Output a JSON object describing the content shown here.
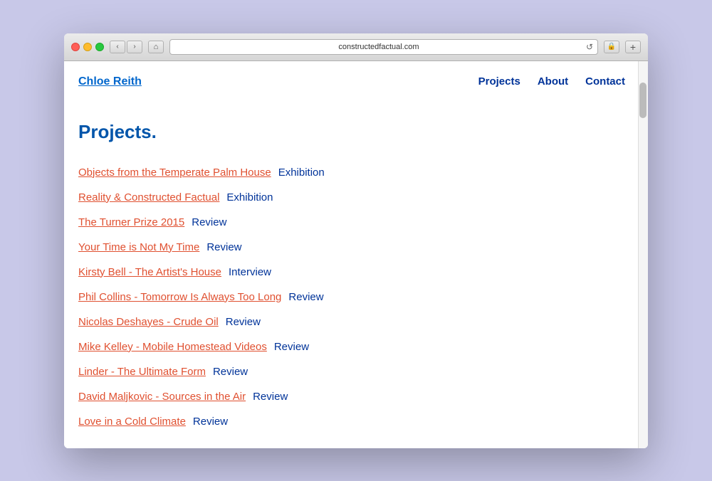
{
  "browser": {
    "url": "constructedfactual.com",
    "back_btn": "‹",
    "forward_btn": "›",
    "home_icon": "⌂",
    "refresh_icon": "↺",
    "security_icon": "⬛",
    "new_tab_icon": "+"
  },
  "site": {
    "logo": "Chloe Reith",
    "nav_links": [
      {
        "label": "Projects",
        "href": "#"
      },
      {
        "label": "About",
        "href": "#"
      },
      {
        "label": "Contact",
        "href": "#"
      }
    ]
  },
  "main": {
    "title": "Projects.",
    "projects": [
      {
        "title": "Objects from the Temperate Palm House",
        "type": "Exhibition"
      },
      {
        "title": "Reality & Constructed Factual",
        "type": "Exhibition"
      },
      {
        "title": "The Turner Prize 2015",
        "type": "Review"
      },
      {
        "title": "Your Time is Not My Time",
        "type": "Review"
      },
      {
        "title": "Kirsty Bell - The Artist's House",
        "type": "Interview"
      },
      {
        "title": "Phil Collins - Tomorrow Is Always Too Long",
        "type": "Review"
      },
      {
        "title": "Nicolas Deshayes - Crude Oil",
        "type": "Review"
      },
      {
        "title": "Mike Kelley - Mobile Homestead Videos",
        "type": "Review"
      },
      {
        "title": "Linder - The Ultimate Form",
        "type": "Review"
      },
      {
        "title": "David Maljkovic - Sources in the Air",
        "type": "Review"
      },
      {
        "title": "Love in a Cold Climate",
        "type": "Review"
      }
    ]
  }
}
